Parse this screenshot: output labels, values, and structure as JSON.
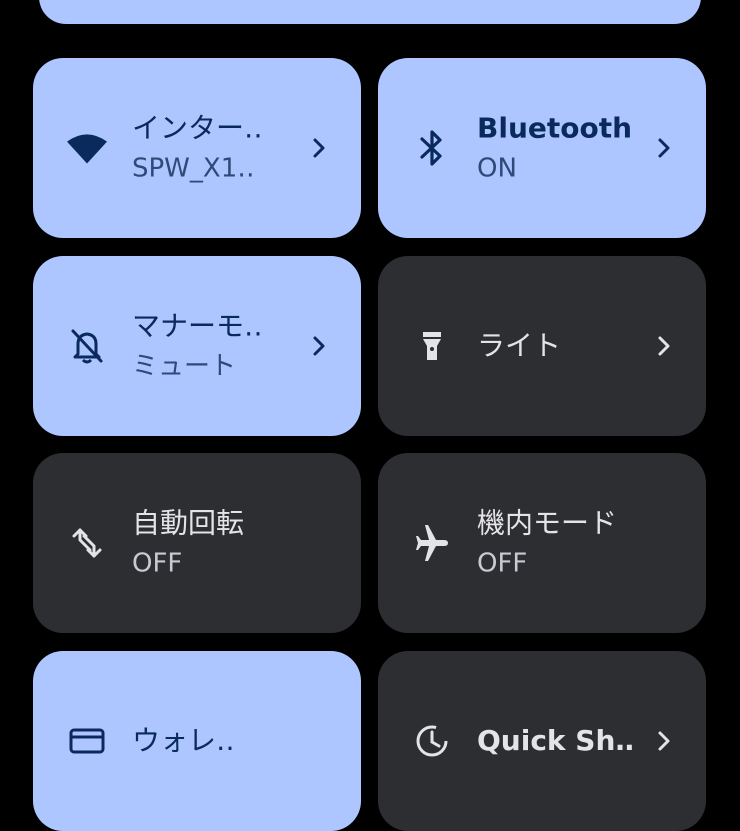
{
  "colors": {
    "tile_on": "#adc6ff",
    "tile_off": "#2d2e32",
    "on_text": "#0b2a5c",
    "off_text": "#e3e3e8"
  },
  "tiles": [
    {
      "label": "インター‥",
      "sub": "SPW_X1‥",
      "icon": "wifi-icon",
      "state": "on",
      "chevron": true
    },
    {
      "label": "Bluetooth",
      "sub": "ON",
      "icon": "bluetooth-icon",
      "state": "on",
      "chevron": true
    },
    {
      "label": "マナーモ‥",
      "sub": "ミュート",
      "icon": "notifications-off-icon",
      "state": "on",
      "chevron": true
    },
    {
      "label": "ライト",
      "sub": "",
      "icon": "flashlight-icon",
      "state": "off",
      "chevron": true
    },
    {
      "label": "自動回転",
      "sub": "OFF",
      "icon": "auto-rotate-icon",
      "state": "off",
      "chevron": false
    },
    {
      "label": "機内モード",
      "sub": "OFF",
      "icon": "airplane-icon",
      "state": "off",
      "chevron": false
    },
    {
      "label": "ウォレ‥",
      "sub": "",
      "icon": "wallet-icon",
      "state": "on",
      "chevron": false
    },
    {
      "label": "Quick Sh‥",
      "sub": "",
      "icon": "quick-share-icon",
      "state": "off",
      "chevron": true
    }
  ]
}
